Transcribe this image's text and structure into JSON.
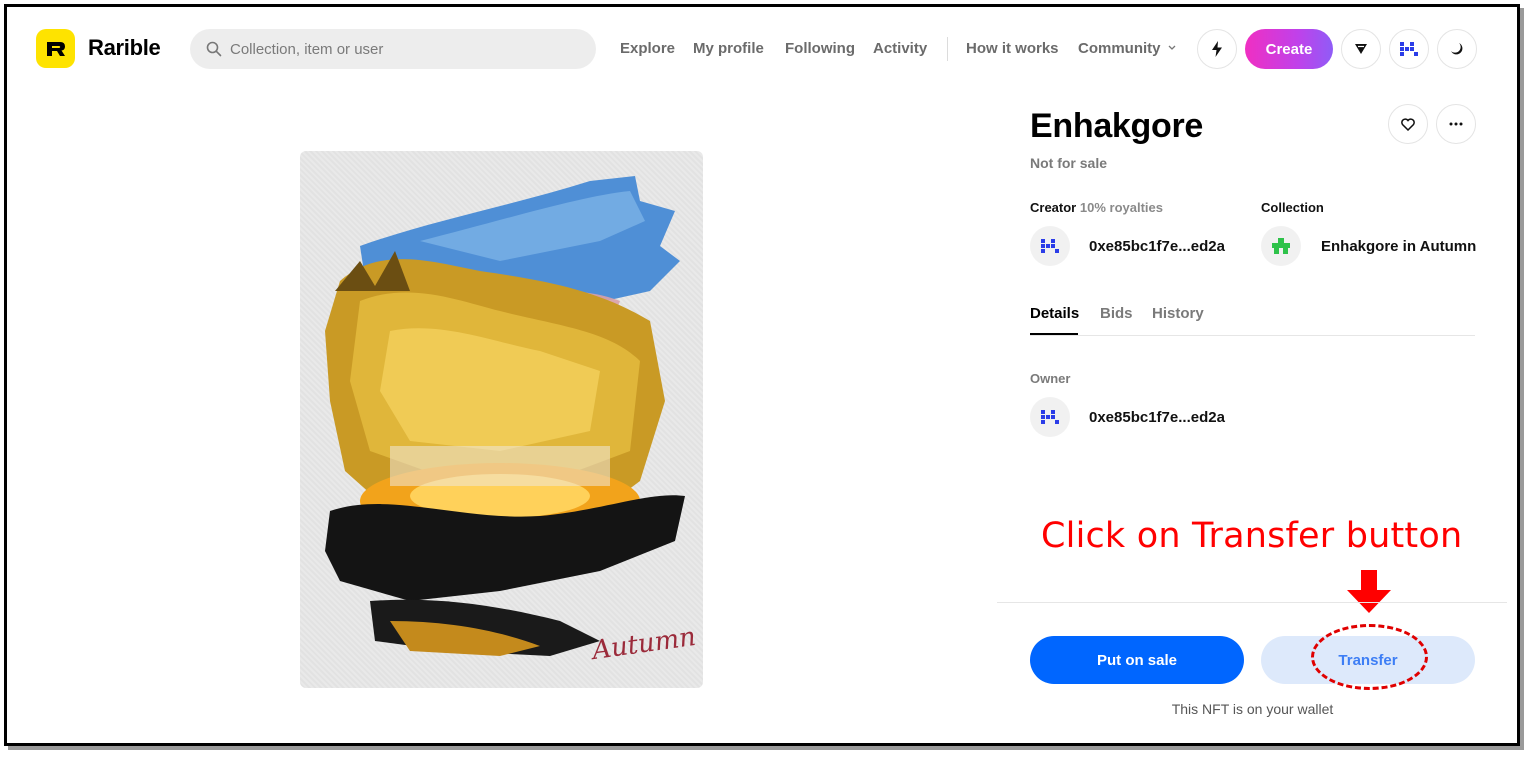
{
  "header": {
    "brand": "Rarible",
    "search_placeholder": "Collection, item or user",
    "nav": {
      "explore": "Explore",
      "my_profile": "My profile",
      "following": "Following",
      "activity": "Activity",
      "how_it_works": "How it works",
      "community": "Community"
    },
    "create_label": "Create",
    "icons": [
      "bolt-icon",
      "dropdown-triangle-icon",
      "user-avatar-icon",
      "moon-icon"
    ]
  },
  "artwork": {
    "signature": "Autumn"
  },
  "item": {
    "title": "Enhakgore",
    "sale_status": "Not for sale",
    "creator_label": "Creator",
    "royalties": "10% royalties",
    "creator_address": "0xe85bc1f7e...ed2a",
    "collection_label": "Collection",
    "collection_name": "Enhakgore in Autumn",
    "tabs": [
      "Details",
      "Bids",
      "History"
    ],
    "owner_label": "Owner",
    "owner_address": "0xe85bc1f7e...ed2a"
  },
  "actions": {
    "put_on_sale": "Put on sale",
    "transfer": "Transfer",
    "wallet_note": "This NFT is on your wallet"
  },
  "annotation": {
    "text": "Click on Transfer button",
    "color": "#ff0000"
  },
  "colors": {
    "primary": "#0066ff",
    "create_gradient_start": "#f02fc2",
    "create_gradient_end": "#8f5cf7",
    "logo": "#fee300"
  }
}
